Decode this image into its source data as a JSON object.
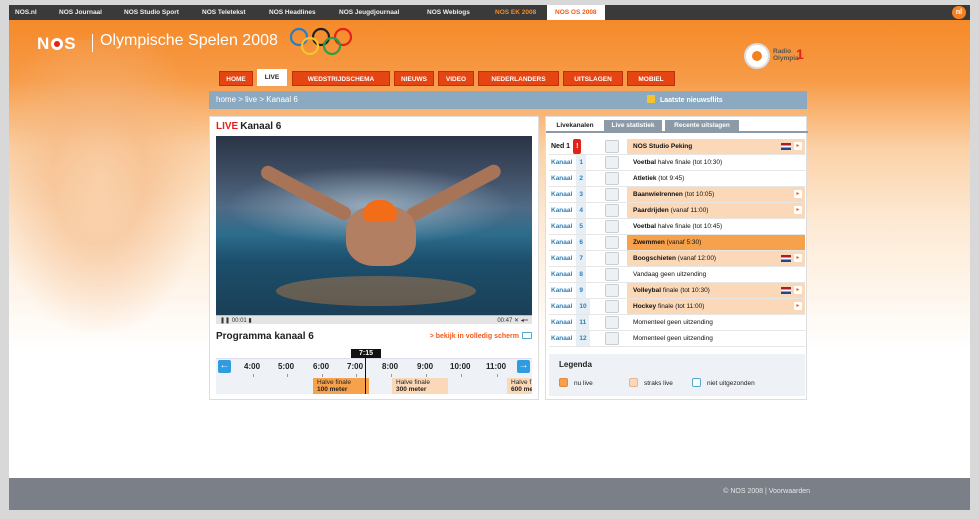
{
  "topnav": {
    "links": [
      "NOS.nl",
      "NOS Journaal",
      "NOS Studio Sport",
      "NOS Teletekst",
      "NOS Headlines",
      "NOS Jeugdjournaal",
      "NOS Weblogs",
      "NOS EK 2008",
      "NOS OS 2008"
    ],
    "active": "NOS OS 2008",
    "logo": "nl"
  },
  "header": {
    "brand": "NOS",
    "title": "Olympische Spelen 2008",
    "radio_line1": "Radio",
    "radio_line2": "Olympia",
    "radio_number": "1"
  },
  "mainnav": {
    "tabs": [
      "HOME",
      "LIVE",
      "WEDSTRIJDSCHEMA",
      "NIEUWS",
      "VIDEO",
      "NEDERLANDERS",
      "UITSLAGEN",
      "MOBIEL"
    ],
    "active": "LIVE"
  },
  "breadcrumb": "home > live > Kanaal 6",
  "newsflash": "Laatste nieuwsflits",
  "player": {
    "live_label": "LIVE",
    "channel": "Kanaal 6",
    "time_elapsed": "00:01",
    "time_total": "00:47"
  },
  "programma": {
    "title": "Programma kanaal 6",
    "fullscreen": "> bekijk in volledig scherm",
    "now": "7:15",
    "hours": [
      "4:00",
      "5:00",
      "6:00",
      "7:00",
      "8:00",
      "9:00",
      "10:00",
      "11:00"
    ],
    "programs": [
      {
        "l1": "Halve finale",
        "l2": "100 meter"
      },
      {
        "l1": "Halve finale",
        "l2": "300 meter"
      },
      {
        "l1": "Halve f",
        "l2": "600 me"
      }
    ],
    "prev_arrow": "←",
    "next_arrow": "→"
  },
  "livekanalen": {
    "tabs": [
      "Livekanalen",
      "Live statistiek",
      "Recente uitslagen"
    ],
    "active": "Livekanalen",
    "rows": [
      {
        "name": "Ned 1",
        "num": "!",
        "sport": "NOS Studio Peking",
        "extra": "",
        "status": "soon",
        "flag": true,
        "play": true
      },
      {
        "name": "Kanaal",
        "num": "1",
        "sport": "Voetbal",
        "extra": "halve finale  (tot 10:30)",
        "status": "none",
        "flag": false,
        "play": false
      },
      {
        "name": "Kanaal",
        "num": "2",
        "sport": "Atletiek",
        "extra": "(tot 9:45)",
        "status": "none",
        "flag": false,
        "play": false
      },
      {
        "name": "Kanaal",
        "num": "3",
        "sport": "Baanwielrennen",
        "extra": "(tot 10:05)",
        "status": "soon",
        "flag": false,
        "play": true
      },
      {
        "name": "Kanaal",
        "num": "4",
        "sport": "Paardrijden",
        "extra": "(vanaf 11:00)",
        "status": "soon",
        "flag": false,
        "play": true
      },
      {
        "name": "Kanaal",
        "num": "5",
        "sport": "Voetbal",
        "extra": "halve finale  (tot 10:45)",
        "status": "none",
        "flag": false,
        "play": false
      },
      {
        "name": "Kanaal",
        "num": "6",
        "sport": "Zwemmen",
        "extra": "(vanaf 5:30)",
        "status": "live",
        "flag": false,
        "play": false
      },
      {
        "name": "Kanaal",
        "num": "7",
        "sport": "Boogschieten",
        "extra": "(vanaf 12:00)",
        "status": "soon",
        "flag": true,
        "play": true
      },
      {
        "name": "Kanaal",
        "num": "8",
        "sport": "",
        "extra": "Vandaag geen uitzending",
        "status": "none",
        "flag": false,
        "play": false
      },
      {
        "name": "Kanaal",
        "num": "9",
        "sport": "Volleybal",
        "extra": "finale  (tot 10:30)",
        "status": "soon",
        "flag": true,
        "play": true
      },
      {
        "name": "Kanaal",
        "num": "10",
        "sport": "Hockey",
        "extra": "finale  (tot 11:00)",
        "status": "soon",
        "flag": false,
        "play": true
      },
      {
        "name": "Kanaal",
        "num": "11",
        "sport": "",
        "extra": "Momenteel geen uitzending",
        "status": "none",
        "flag": false,
        "play": false
      },
      {
        "name": "Kanaal",
        "num": "12",
        "sport": "",
        "extra": "Momenteel geen uitzending",
        "status": "none",
        "flag": false,
        "play": false
      }
    ],
    "play_glyph": "▸"
  },
  "legend": {
    "title": "Legenda",
    "items": [
      "nu live",
      "straks live",
      "niet uitgezonden"
    ],
    "colors": [
      "#f6a14c",
      "#fbd8b8",
      "#ffffff"
    ]
  },
  "footer": "© NOS 2008 | Voorwaarden",
  "colors": {
    "accent": "#e54513",
    "brand_red": "#e2231a",
    "live_orange": "#f6a14c",
    "soon_orange": "#fbd8b8",
    "breadcrumb_blue": "#8ca9c2"
  }
}
